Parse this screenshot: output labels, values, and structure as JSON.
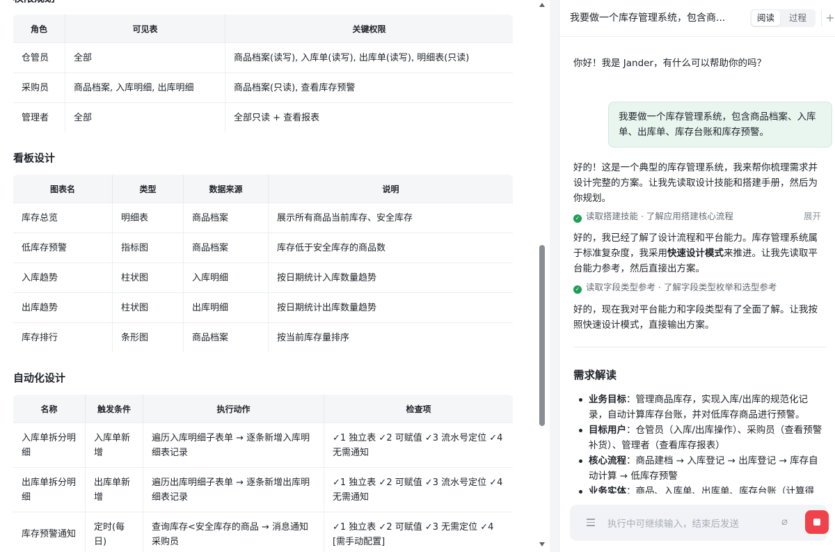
{
  "doc": {
    "permissions": {
      "title": "权限规划",
      "headers": [
        "角色",
        "可见表",
        "关键权限"
      ],
      "rows": [
        [
          "仓管员",
          "全部",
          "商品档案(读写), 入库单(读写), 出库单(读写), 明细表(只读)"
        ],
        [
          "采购员",
          "商品档案, 入库明细, 出库明细",
          "商品档案(只读), 查看库存预警"
        ],
        [
          "管理者",
          "全部",
          "全部只读 + 查看报表"
        ]
      ]
    },
    "dashboard": {
      "title": "看板设计",
      "headers": [
        "图表名",
        "类型",
        "数据来源",
        "说明"
      ],
      "rows": [
        [
          "库存总览",
          "明细表",
          "商品档案",
          "展示所有商品当前库存、安全库存"
        ],
        [
          "低库存预警",
          "指标图",
          "商品档案",
          "库存低于安全库存的商品数"
        ],
        [
          "入库趋势",
          "柱状图",
          "入库明细",
          "按日期统计入库数量趋势"
        ],
        [
          "出库趋势",
          "柱状图",
          "出库明细",
          "按日期统计出库数量趋势"
        ],
        [
          "库存排行",
          "条形图",
          "商品档案",
          "按当前库存量排序"
        ]
      ]
    },
    "automation": {
      "title": "自动化设计",
      "headers": [
        "名称",
        "触发条件",
        "执行动作",
        "检查项"
      ],
      "rows": [
        [
          "入库单拆分明细",
          "入库单新增",
          "遍历入库明细子表单 → 逐条新增入库明细表记录",
          "✓1 独立表 ✓2 可赋值 ✓3 流水号定位 ✓4 无需通知"
        ],
        [
          "出库单拆分明细",
          "出库单新增",
          "遍历出库明细子表单 → 逐条新增出库明细表记录",
          "✓1 独立表 ✓2 可赋值 ✓3 流水号定位 ✓4 无需通知"
        ],
        [
          "库存预警通知",
          "定时(每日)",
          "查询库存<安全库存的商品 → 消息通知采购员",
          "✓1 独立表 ✓2 可赋值 ✓3 无需定位 ✓4 [需手动配置]"
        ]
      ]
    }
  },
  "chat": {
    "title": "我要做一个库存管理系统，包含商...",
    "toggle": {
      "read": "阅读",
      "process": "过程"
    },
    "plus": "+",
    "greeting": "你好！我是 Jander，有什么可以帮助你的吗？",
    "user_message": "我要做一个库存管理系统，包含商品档案、入库单、出库单、库存台账和库存预警。",
    "reply1": "好的！这是一个典型的库存管理系统，我来帮你梳理需求并设计完整的方案。让我先读取设计技能和搭建手册，然后为你规划。",
    "step1": {
      "label": "读取搭建技能 · 了解应用搭建核心流程",
      "expand": "展开"
    },
    "reply2_before": "好的，我已经了解了设计流程和平台能力。库存管理系统属于标准复杂度，我采用",
    "reply2_bold": "快速设计模式",
    "reply2_after": "来推进。让我先读取平台能力参考，然后直接出方案。",
    "step2": {
      "label": "读取字段类型参考 · 了解字段类型枚举和选型参考"
    },
    "reply3": "好的，现在我对平台能力和字段类型有了全面了解。让我按照快速设计模式，直接输出方案。",
    "req_title": "需求解读",
    "req_items": [
      {
        "label": "业务目标",
        "text": "：管理商品库存，实现入库/出库的规范化记录，自动计算库存台账，并对低库存商品进行预警。"
      },
      {
        "label": "目标用户",
        "text": "：仓管员（入库/出库操作）、采购员（查看预警补货）、管理者（查看库存报表）"
      },
      {
        "label": "核心流程",
        "text": "：商品建档 → 入库登记 → 出库登记 → 库存自动计算 → 低库存预警"
      },
      {
        "label": "业务实体",
        "text": "：商品、入库单、出库单、库存台账（计算得出）"
      }
    ],
    "input_placeholder": "执行中可继续输入，结束后发送"
  },
  "colors": {
    "accent_green": "#1f9d55",
    "stop_red": "#f0424a",
    "bubble_bg": "#e8f6ef"
  },
  "icons": [
    "check-icon",
    "menu-icon",
    "paperclip-icon",
    "stop-icon",
    "plus-icon",
    "scroll-up-icon",
    "scroll-down-icon"
  ]
}
